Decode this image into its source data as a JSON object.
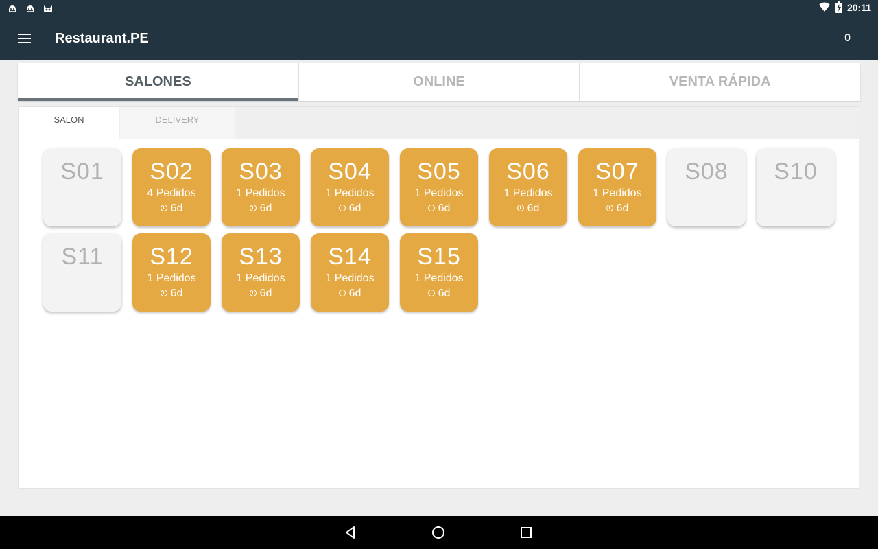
{
  "status_bar": {
    "time": "20:11",
    "left_icons": [
      "android-debug-icon",
      "android-debug-icon",
      "cat-icon"
    ],
    "right_icons": [
      "wifi-icon",
      "battery-charging-icon"
    ]
  },
  "app_bar": {
    "title": "Restaurant.PE",
    "count": "0",
    "menu_icon": "menu-icon"
  },
  "main_tabs": [
    {
      "label": "SALONES",
      "active": true
    },
    {
      "label": "ONLINE",
      "active": false
    },
    {
      "label": "VENTA RÁPIDA",
      "active": false
    }
  ],
  "sub_tabs": [
    {
      "label": "SALON",
      "active": true
    },
    {
      "label": "DELIVERY",
      "active": false
    }
  ],
  "tables": [
    {
      "code": "S01",
      "status": "free",
      "orders": "",
      "time": ""
    },
    {
      "code": "S02",
      "status": "occupied",
      "orders": "4 Pedidos",
      "time": "6d"
    },
    {
      "code": "S03",
      "status": "occupied",
      "orders": "1 Pedidos",
      "time": "6d"
    },
    {
      "code": "S04",
      "status": "occupied",
      "orders": "1 Pedidos",
      "time": "6d"
    },
    {
      "code": "S05",
      "status": "occupied",
      "orders": "1 Pedidos",
      "time": "6d"
    },
    {
      "code": "S06",
      "status": "occupied",
      "orders": "1 Pedidos",
      "time": "6d"
    },
    {
      "code": "S07",
      "status": "occupied",
      "orders": "1 Pedidos",
      "time": "6d"
    },
    {
      "code": "S08",
      "status": "free",
      "orders": "",
      "time": ""
    },
    {
      "code": "S10",
      "status": "free",
      "orders": "",
      "time": ""
    },
    {
      "code": "S11",
      "status": "free",
      "orders": "",
      "time": ""
    },
    {
      "code": "S12",
      "status": "occupied",
      "orders": "1 Pedidos",
      "time": "6d"
    },
    {
      "code": "S13",
      "status": "occupied",
      "orders": "1 Pedidos",
      "time": "6d"
    },
    {
      "code": "S14",
      "status": "occupied",
      "orders": "1 Pedidos",
      "time": "6d"
    },
    {
      "code": "S15",
      "status": "occupied",
      "orders": "1 Pedidos",
      "time": "6d"
    }
  ],
  "colors": {
    "app_bar": "#22343f",
    "occupied_table": "#e5a944",
    "free_table": "#f3f3f3"
  },
  "nav_bar": {
    "buttons": [
      "back-icon",
      "home-icon",
      "recents-icon"
    ]
  }
}
